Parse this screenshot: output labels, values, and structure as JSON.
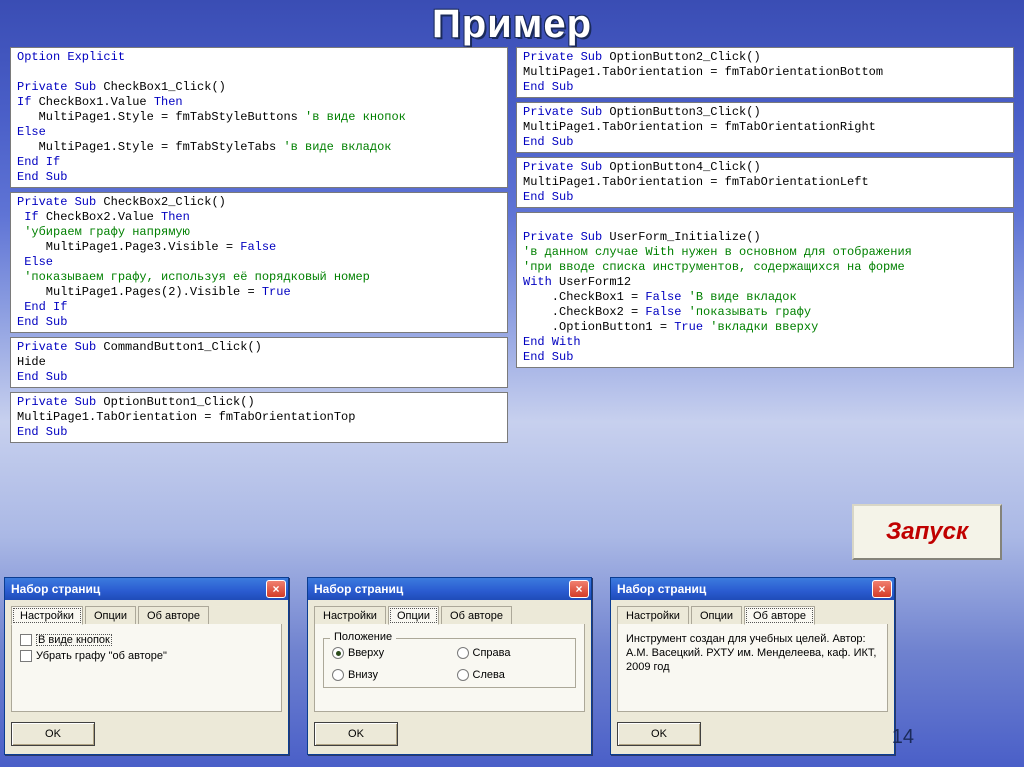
{
  "slide": {
    "title": "Пример",
    "page_number": "14"
  },
  "launch_button": "Запуск",
  "code_left": [
    [
      {
        "t": "Option Explicit",
        "c": "kw"
      },
      {
        "t": ""
      },
      {
        "t": "Private Sub ",
        "c": "kw",
        "a": "CheckBox1_Click()"
      },
      {
        "t": "If ",
        "c": "kw",
        "a": "CheckBox1.Value ",
        "a2": "Then",
        "c2": "kw"
      },
      {
        "t": "   MultiPage1.Style = fmTabStyleButtons ",
        "cm": "'в виде кнопок"
      },
      {
        "t": "Else",
        "c": "kw"
      },
      {
        "t": "   MultiPage1.Style = fmTabStyleTabs ",
        "cm": "'в виде вкладок"
      },
      {
        "t": "End If",
        "c": "kw"
      },
      {
        "t": "End Sub",
        "c": "kw"
      }
    ],
    [
      {
        "t": "Private Sub ",
        "c": "kw",
        "a": "CheckBox2_Click()"
      },
      {
        "t": " If ",
        "c": "kw",
        "a": "CheckBox2.Value ",
        "a2": "Then",
        "c2": "kw"
      },
      {
        "t": " ",
        "cm": "'убираем графу напрямую"
      },
      {
        "t": "    MultiPage1.Page3.Visible = ",
        "a2": "False",
        "c2": "kw"
      },
      {
        "t": " Else",
        "c": "kw"
      },
      {
        "t": " ",
        "cm": "'показываем графу, используя её порядковый номер"
      },
      {
        "t": "    MultiPage1.Pages(2).Visible = ",
        "a2": "True",
        "c2": "kw"
      },
      {
        "t": " End If",
        "c": "kw"
      },
      {
        "t": "End Sub",
        "c": "kw"
      }
    ],
    [
      {
        "t": "Private Sub ",
        "c": "kw",
        "a": "CommandButton1_Click()"
      },
      {
        "t": "Hide"
      },
      {
        "t": "End Sub",
        "c": "kw"
      }
    ],
    [
      {
        "t": "Private Sub ",
        "c": "kw",
        "a": "OptionButton1_Click()"
      },
      {
        "t": "MultiPage1.TabOrientation = fmTabOrientationTop"
      },
      {
        "t": "End Sub",
        "c": "kw"
      }
    ]
  ],
  "code_right": [
    [
      {
        "t": "Private Sub ",
        "c": "kw",
        "a": "OptionButton2_Click()"
      },
      {
        "t": "MultiPage1.TabOrientation = fmTabOrientationBottom"
      },
      {
        "t": "End Sub",
        "c": "kw"
      }
    ],
    [
      {
        "t": "Private Sub ",
        "c": "kw",
        "a": "OptionButton3_Click()"
      },
      {
        "t": "MultiPage1.TabOrientation = fmTabOrientationRight"
      },
      {
        "t": "End Sub",
        "c": "kw"
      }
    ],
    [
      {
        "t": "Private Sub ",
        "c": "kw",
        "a": "OptionButton4_Click()"
      },
      {
        "t": "MultiPage1.TabOrientation = fmTabOrientationLeft"
      },
      {
        "t": "End Sub",
        "c": "kw"
      }
    ],
    [
      {
        "t": ""
      },
      {
        "t": "Private Sub ",
        "c": "kw",
        "a": "UserForm_Initialize()"
      },
      {
        "t": "",
        "cm": "'в данном случае With нужен в основном для отображения"
      },
      {
        "t": "",
        "cm": "'при вводе списка инструментов, содержащихся на форме"
      },
      {
        "t": "With ",
        "c": "kw",
        "a": "UserForm12"
      },
      {
        "t": "    .CheckBox1 = ",
        "a2": "False ",
        "c2": "kw",
        "cm": "'В виде вкладок"
      },
      {
        "t": "    .CheckBox2 = ",
        "a2": "False ",
        "c2": "kw",
        "cm": "'показывать графу"
      },
      {
        "t": "    .OptionButton1 = ",
        "a2": "True ",
        "c2": "kw",
        "cm": "'вкладки вверху"
      },
      {
        "t": "End With",
        "c": "kw"
      },
      {
        "t": "End Sub",
        "c": "kw"
      }
    ]
  ],
  "form_common": {
    "title": "Набор страниц",
    "tabs": [
      "Настройки",
      "Опции",
      "Об авторе"
    ],
    "ok": "OK"
  },
  "form1": {
    "active_tab": 0,
    "chk1": "В виде кнопок",
    "chk2": "Убрать графу \"об авторе\""
  },
  "form2": {
    "active_tab": 1,
    "frame_title": "Положение",
    "radios": [
      "Вверху",
      "Справа",
      "Внизу",
      "Слева"
    ],
    "selected": 0
  },
  "form3": {
    "active_tab": 2,
    "about": "Инструмент создан для учебных целей. Автор: А.М. Васецкий. РХТУ им. Менделеева, каф. ИКТ, 2009 год"
  }
}
